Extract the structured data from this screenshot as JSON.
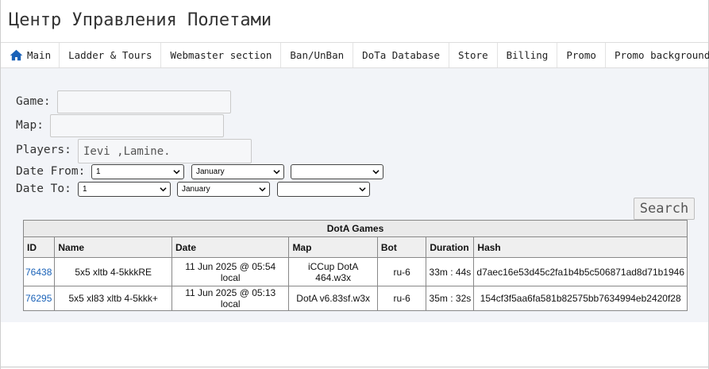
{
  "header": {
    "title": "Центр Управления Полетами"
  },
  "nav": {
    "items": [
      {
        "label": "Main",
        "icon": "home-icon"
      },
      {
        "label": "Ladder & Tours"
      },
      {
        "label": "Webmaster section"
      },
      {
        "label": "Ban/UnBan"
      },
      {
        "label": "DoTa Database"
      },
      {
        "label": "Store"
      },
      {
        "label": "Billing"
      },
      {
        "label": "Promo"
      },
      {
        "label": "Promo background"
      }
    ],
    "accent_color": "#1a62b8"
  },
  "form": {
    "game_label": "Game:",
    "game_value": "",
    "map_label": "Map:",
    "map_value": "",
    "players_label": "Players:",
    "players_value": "Ievi ,Lamine.",
    "date_from_label": "Date From:",
    "date_from": {
      "day": "1",
      "month": "January",
      "year": ""
    },
    "date_to_label": "Date To:",
    "date_to": {
      "day": "1",
      "month": "January",
      "year": ""
    },
    "search_label": "Search"
  },
  "table": {
    "caption": "DotA Games",
    "columns": [
      "ID",
      "Name",
      "Date",
      "Map",
      "Bot",
      "Duration",
      "Hash"
    ],
    "rows": [
      {
        "id": "76438",
        "name": "5x5 xltb 4-5kkkRE",
        "date": "11 Jun 2025 @ 05:54 local",
        "map": "iCCup DotA 464.w3x",
        "bot": "ru-6",
        "duration": "33m : 44s",
        "hash": "d7aec16e53d45c2fa1b4b5c506871ad8d71b1946"
      },
      {
        "id": "76295",
        "name": "5x5 xl83 xltb 4-5kkk+",
        "date": "11 Jun 2025 @ 05:13 local",
        "map": "DotA v6.83sf.w3x",
        "bot": "ru-6",
        "duration": "35m : 32s",
        "hash": "154cf3f5aa6fa581b82575bb7634994eb2420f28"
      }
    ]
  }
}
